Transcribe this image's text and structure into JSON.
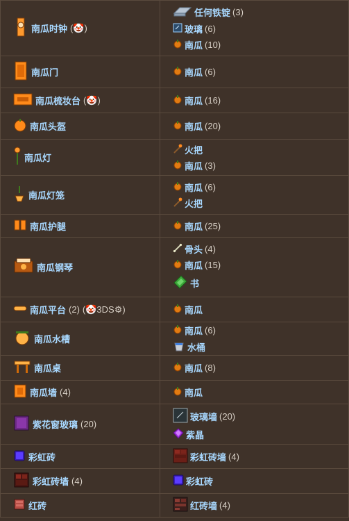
{
  "rows": [
    {
      "result": "南瓜时钟",
      "badge": "(🤡)",
      "qty": "",
      "ings": [
        {
          "name": "任何铁锭",
          "qty": "(3)",
          "icon": "iron-bar-icon"
        },
        {
          "name": "玻璃",
          "qty": "(6)",
          "icon": "glass-icon"
        },
        {
          "name": "南瓜",
          "qty": "(10)",
          "icon": "pumpkin-icon"
        }
      ]
    },
    {
      "result": "南瓜门",
      "ings": [
        {
          "name": "南瓜",
          "qty": "(6)",
          "icon": "pumpkin-icon"
        }
      ]
    },
    {
      "result": "南瓜梳妆台",
      "badge": "(🤡)",
      "ings": [
        {
          "name": "南瓜",
          "qty": "(16)",
          "icon": "pumpkin-icon"
        }
      ]
    },
    {
      "result": "南瓜头盔",
      "ings": [
        {
          "name": "南瓜",
          "qty": "(20)",
          "icon": "pumpkin-icon"
        }
      ]
    },
    {
      "result": "南瓜灯",
      "ings": [
        {
          "name": "火把",
          "qty": "",
          "icon": "torch-icon"
        },
        {
          "name": "南瓜",
          "qty": "(3)",
          "icon": "pumpkin-icon"
        }
      ]
    },
    {
      "result": "南瓜灯笼",
      "ings": [
        {
          "name": "南瓜",
          "qty": "(6)",
          "icon": "pumpkin-icon"
        },
        {
          "name": "火把",
          "qty": "",
          "icon": "torch-icon"
        }
      ]
    },
    {
      "result": "南瓜护腿",
      "ings": [
        {
          "name": "南瓜",
          "qty": "(25)",
          "icon": "pumpkin-icon"
        }
      ]
    },
    {
      "result": "南瓜钢琴",
      "ings": [
        {
          "name": "骨头",
          "qty": "(4)",
          "icon": "bone-icon"
        },
        {
          "name": "南瓜",
          "qty": "(15)",
          "icon": "pumpkin-icon"
        },
        {
          "name": "书",
          "qty": "",
          "icon": "book-icon"
        }
      ]
    },
    {
      "result": "南瓜平台",
      "qty": "(2)",
      "badge": "(🤡3DS⚙)",
      "ings": [
        {
          "name": "南瓜",
          "qty": "",
          "icon": "pumpkin-icon"
        }
      ]
    },
    {
      "result": "南瓜水槽",
      "ings": [
        {
          "name": "南瓜",
          "qty": "(6)",
          "icon": "pumpkin-icon"
        },
        {
          "name": "水桶",
          "qty": "",
          "icon": "water-bucket-icon"
        }
      ]
    },
    {
      "result": "南瓜桌",
      "ings": [
        {
          "name": "南瓜",
          "qty": "(8)",
          "icon": "pumpkin-icon"
        }
      ]
    },
    {
      "result": "南瓜墙",
      "qty": "(4)",
      "ings": [
        {
          "name": "南瓜",
          "qty": "",
          "icon": "pumpkin-icon"
        }
      ]
    },
    {
      "result": "紫花窗玻璃",
      "qty": "(20)",
      "ings": [
        {
          "name": "玻璃墙",
          "qty": "(20)",
          "icon": "glass-wall-icon"
        },
        {
          "name": "紫晶",
          "qty": "",
          "icon": "amethyst-icon"
        }
      ]
    },
    {
      "result": "彩虹砖",
      "ings": [
        {
          "name": "彩虹砖墙",
          "qty": "(4)",
          "icon": "rainbow-brick-wall-icon"
        }
      ]
    },
    {
      "result": "彩虹砖墙",
      "qty": "(4)",
      "ings": [
        {
          "name": "彩虹砖",
          "qty": "",
          "icon": "rainbow-brick-icon"
        }
      ]
    },
    {
      "result": "红砖",
      "ings": [
        {
          "name": "红砖墙",
          "qty": "(4)",
          "icon": "red-brick-wall-icon"
        }
      ]
    }
  ]
}
